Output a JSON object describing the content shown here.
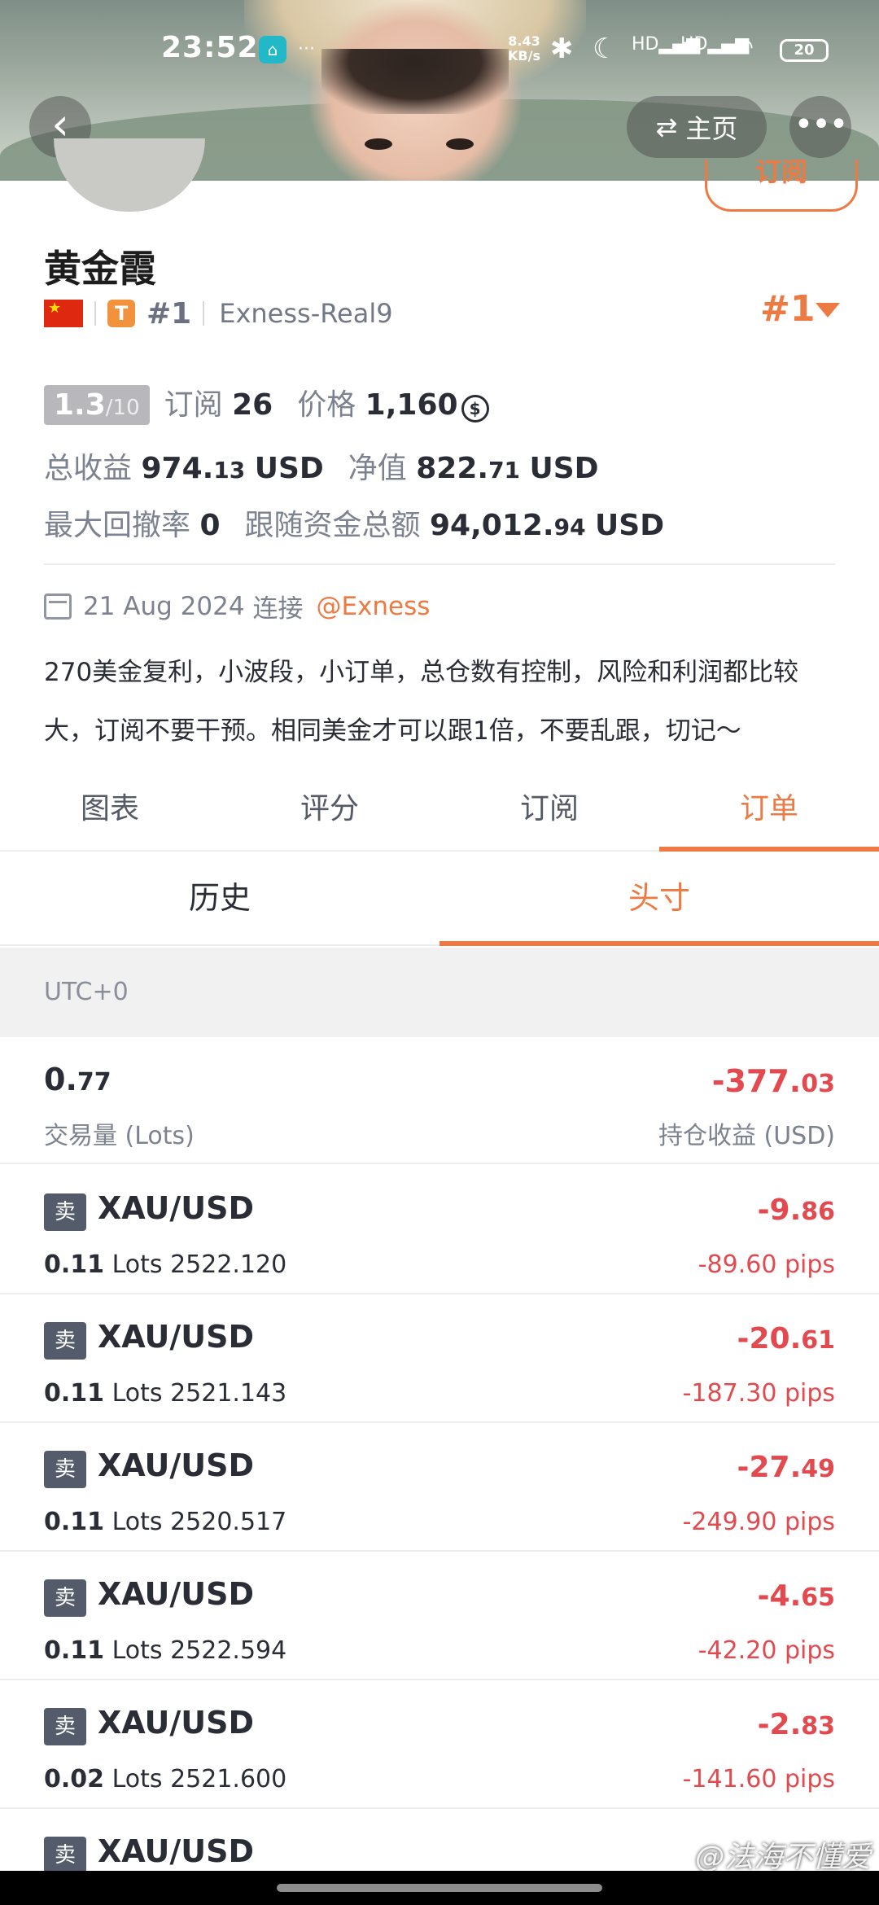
{
  "status_bar": {
    "time": "23:52",
    "net_speed_value": "8.43",
    "net_speed_unit": "KB/s",
    "signal_1": "HD",
    "signal_2": "HD",
    "battery": "20"
  },
  "header": {
    "home_label": "主页",
    "subscribe_label": "订阅"
  },
  "profile": {
    "name": "黄金霞",
    "tier": "T",
    "rank_small": "#1",
    "server": "Exness-Real9",
    "rank_big": "#1",
    "rating": "1.3",
    "rating_out_of": "/10",
    "subscriptions_label": "订阅",
    "subscriptions": "26",
    "price_label": "价格",
    "price": "1,160",
    "total_profit_label": "总收益",
    "total_profit_int": "974.",
    "total_profit_dec": "13",
    "total_profit_unit": "USD",
    "equity_label": "净值",
    "equity_int": "822.",
    "equity_dec": "71",
    "equity_unit": "USD",
    "max_drawdown_label": "最大回撤率",
    "max_drawdown": "0",
    "follower_funds_label": "跟随资金总额",
    "follower_funds_int": "94,012.",
    "follower_funds_dec": "94",
    "follower_funds_unit": "USD",
    "connected_date": "21 Aug 2024",
    "connected_label": "连接",
    "broker": "@Exness",
    "description": "270美金复利，小波段，小订单，总仓数有控制，风险和利润都比较大，订阅不要干预。相同美金才可以跟1倍，不要乱跟，切记～"
  },
  "tabs": [
    {
      "label": "图表",
      "active": false
    },
    {
      "label": "评分",
      "active": false
    },
    {
      "label": "订阅",
      "active": false
    },
    {
      "label": "订单",
      "active": true
    }
  ],
  "subtabs": [
    {
      "label": "历史",
      "active": false
    },
    {
      "label": "头寸",
      "active": true
    }
  ],
  "timezone": "UTC+0",
  "summary": {
    "lots_int": "0.",
    "lots_dec": "77",
    "lots_label": "交易量 (Lots)",
    "pnl_int": "-377.",
    "pnl_dec": "03",
    "pnl_label": "持仓收益 (USD)"
  },
  "orders": [
    {
      "side": "卖",
      "symbol": "XAU/USD",
      "lots": "0.11",
      "lots_unit": "Lots",
      "price": "2522.120",
      "profit_int": "-9.",
      "profit_dec": "86",
      "pips": "-89.60 pips"
    },
    {
      "side": "卖",
      "symbol": "XAU/USD",
      "lots": "0.11",
      "lots_unit": "Lots",
      "price": "2521.143",
      "profit_int": "-20.",
      "profit_dec": "61",
      "pips": "-187.30 pips"
    },
    {
      "side": "卖",
      "symbol": "XAU/USD",
      "lots": "0.11",
      "lots_unit": "Lots",
      "price": "2520.517",
      "profit_int": "-27.",
      "profit_dec": "49",
      "pips": "-249.90 pips"
    },
    {
      "side": "卖",
      "symbol": "XAU/USD",
      "lots": "0.11",
      "lots_unit": "Lots",
      "price": "2522.594",
      "profit_int": "-4.",
      "profit_dec": "65",
      "pips": "-42.20 pips"
    },
    {
      "side": "卖",
      "symbol": "XAU/USD",
      "lots": "0.02",
      "lots_unit": "Lots",
      "price": "2521.600",
      "profit_int": "-2.",
      "profit_dec": "83",
      "pips": "-141.60 pips"
    },
    {
      "side": "卖",
      "symbol": "XAU/USD"
    }
  ],
  "watermark": "@法海不懂爱"
}
